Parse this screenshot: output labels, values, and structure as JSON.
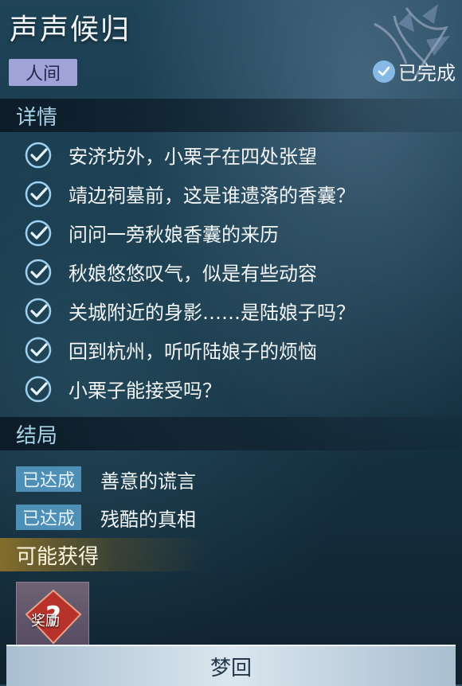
{
  "header": {
    "title": "声声候归",
    "realm_tag": "人间",
    "status_label": "已完成"
  },
  "details": {
    "heading": "详情",
    "tasks": [
      "安济坊外，小栗子在四处张望",
      "靖边祠墓前，这是谁遗落的香囊？",
      "问问一旁秋娘香囊的来历",
      "秋娘悠悠叹气，似是有些动容",
      "关城附近的身影……是陆娘子吗？",
      "回到杭州，听听陆娘子的烦恼",
      "小栗子能接受吗？"
    ]
  },
  "endings": {
    "heading": "结局",
    "items": [
      {
        "badge": "已达成",
        "label": "善意的谎言"
      },
      {
        "badge": "已达成",
        "label": "残酷的真相"
      }
    ]
  },
  "rewards": {
    "heading": "可能获得",
    "item_label": "奖励",
    "item_icon": "question-mark-icon"
  },
  "footer": {
    "button_label": "梦回"
  },
  "colors": {
    "accent_blue": "#86b9e6",
    "tag_purple": "#9fa3d8",
    "badge_blue": "#4d8fb5",
    "section_text": "#a8d3e6"
  }
}
